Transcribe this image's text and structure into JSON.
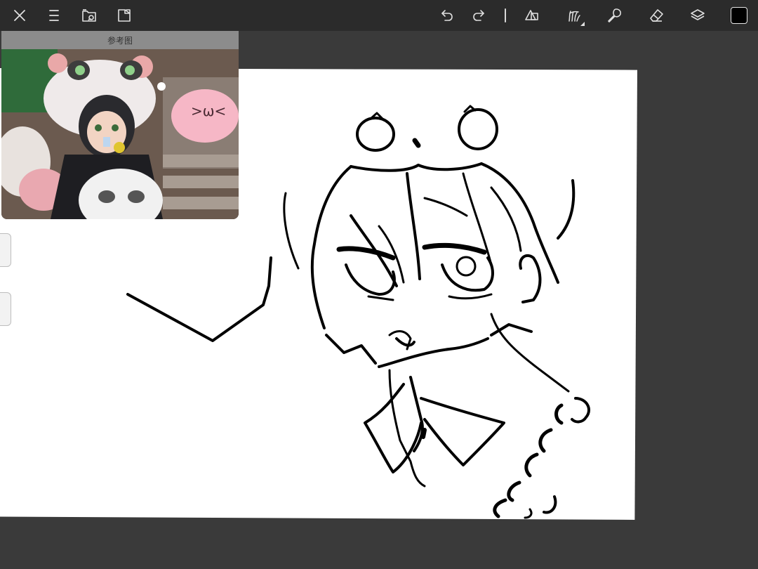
{
  "reference_panel": {
    "title": "参考图"
  },
  "toolbar": {
    "left_icons": [
      "close-icon",
      "menu-icon",
      "gallery-icon",
      "export-icon"
    ],
    "right_icons": [
      "undo-icon",
      "redo-icon",
      "selection-icon",
      "brush-icon",
      "smudge-icon",
      "eraser-icon",
      "layers-icon"
    ],
    "current_color": "#000000"
  },
  "colors": {
    "toolbar_bg": "#2b2b2b",
    "workspace_bg": "#3a3a3a",
    "canvas_bg": "#ffffff",
    "icon": "#e0e0e0"
  }
}
